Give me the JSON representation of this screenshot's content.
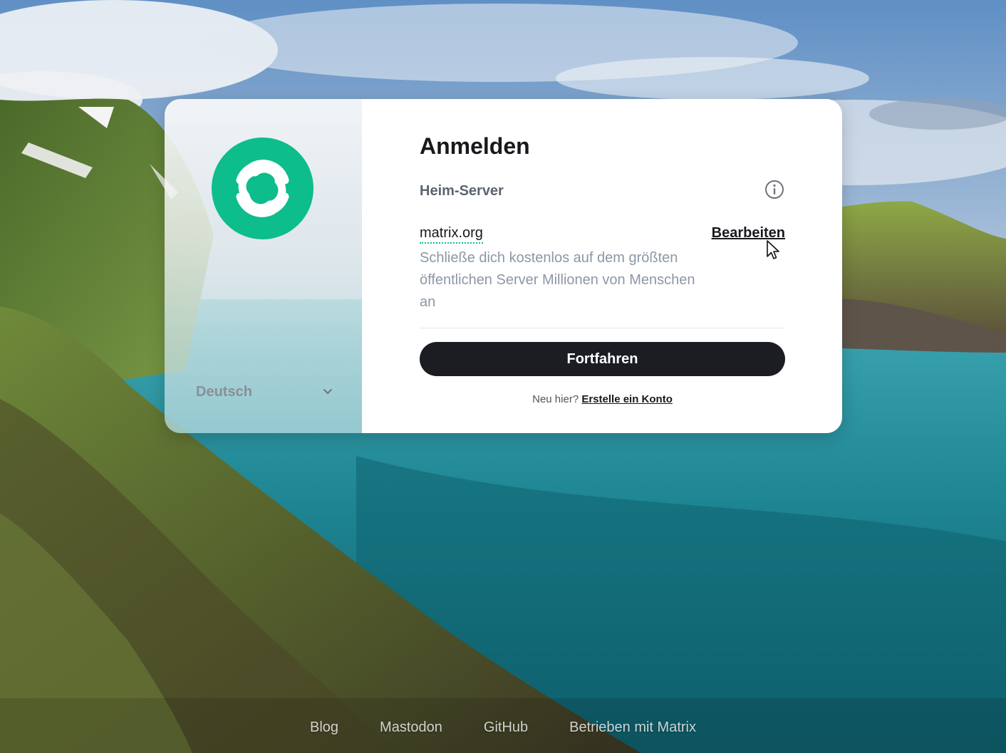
{
  "background": {
    "description_icon": "landscape-background"
  },
  "left_panel": {
    "logo_icon": "element-logo-icon",
    "language": {
      "selected": "Deutsch",
      "icon": "chevron-down-icon"
    }
  },
  "login": {
    "title": "Anmelden",
    "homeserver_label": "Heim-Server",
    "info_icon": "info-icon",
    "server_name": "matrix.org",
    "edit_label": "Bearbeiten",
    "server_description": "Schließe dich kostenlos auf dem größten öffentlichen Server Millionen von Menschen an",
    "continue_label": "Fortfahren",
    "signup_prompt": "Neu hier?",
    "signup_link": "Erstelle ein Konto"
  },
  "footer": {
    "links": [
      "Blog",
      "Mastodon",
      "GitHub",
      "Betrieben mit Matrix"
    ]
  },
  "colors": {
    "accent": "#0dbd8b",
    "button_bg": "#1b1d22",
    "text_primary": "#17191c",
    "text_secondary": "#8d97a5"
  }
}
